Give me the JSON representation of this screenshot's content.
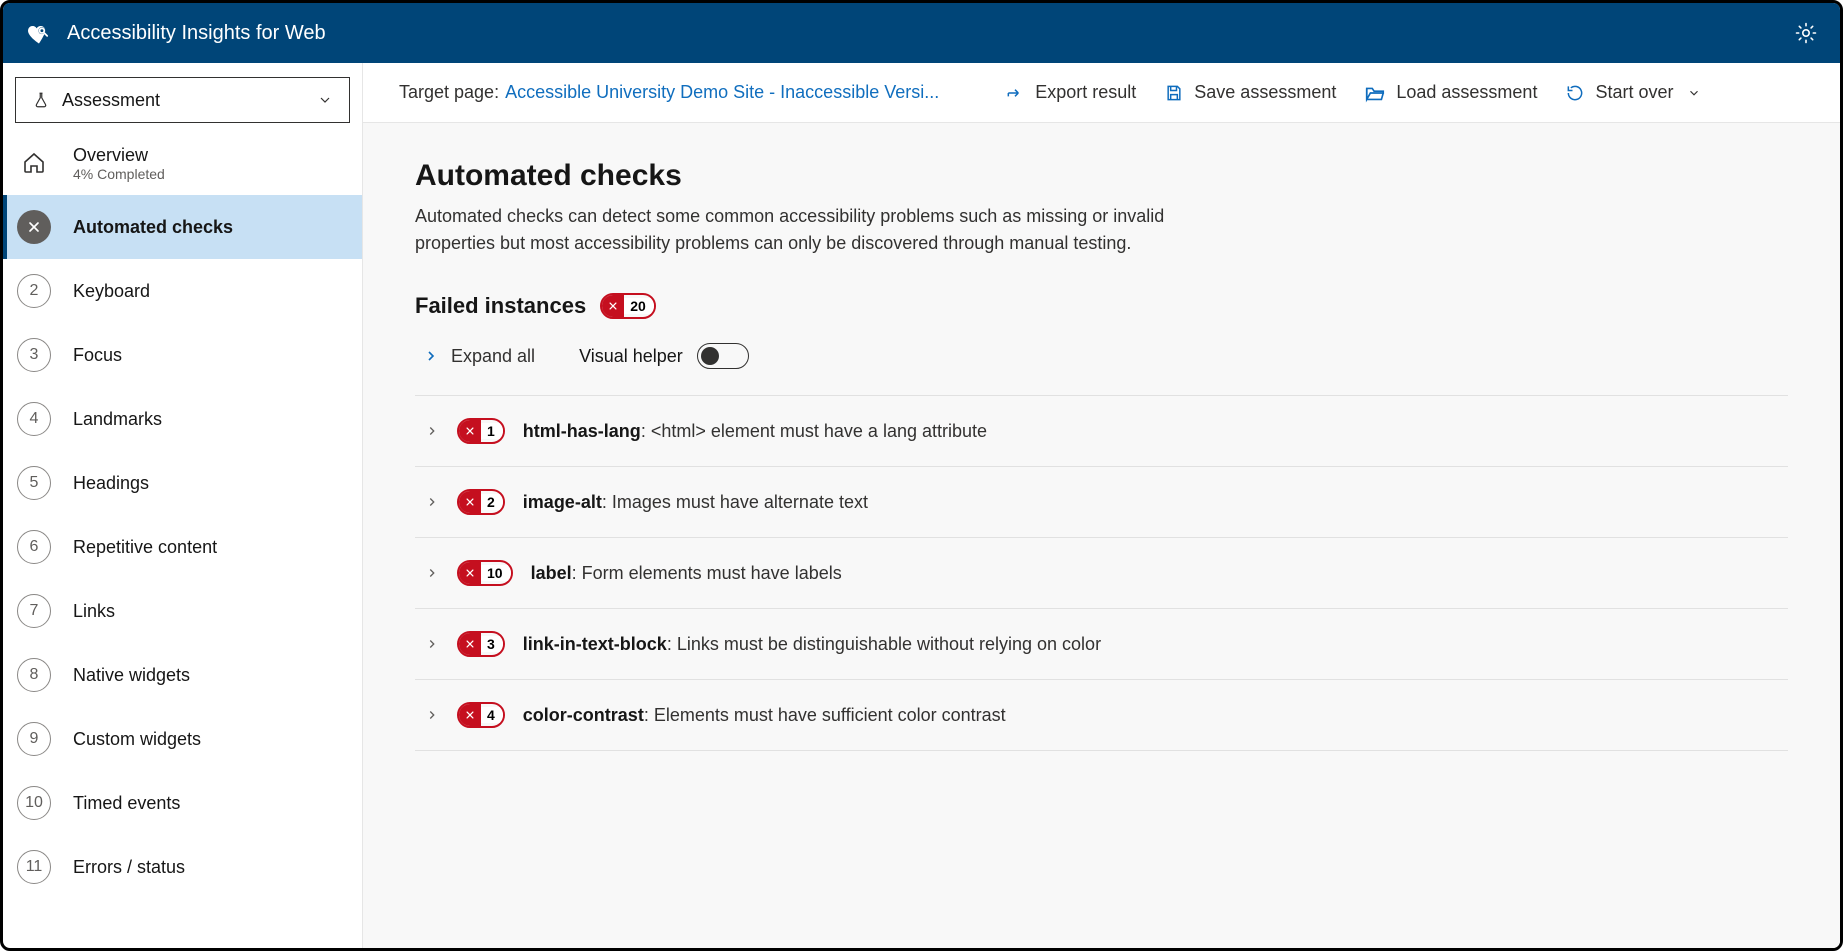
{
  "app": {
    "title": "Accessibility Insights for Web"
  },
  "dropdown": {
    "label": "Assessment"
  },
  "sidebar": {
    "overview": {
      "label": "Overview",
      "sub": "4% Completed"
    },
    "items": [
      {
        "icon": "fail",
        "label": "Automated checks",
        "active": true
      },
      {
        "num": "2",
        "label": "Keyboard"
      },
      {
        "num": "3",
        "label": "Focus"
      },
      {
        "num": "4",
        "label": "Landmarks"
      },
      {
        "num": "5",
        "label": "Headings"
      },
      {
        "num": "6",
        "label": "Repetitive content"
      },
      {
        "num": "7",
        "label": "Links"
      },
      {
        "num": "8",
        "label": "Native widgets"
      },
      {
        "num": "9",
        "label": "Custom widgets"
      },
      {
        "num": "10",
        "label": "Timed events"
      },
      {
        "num": "11",
        "label": "Errors / status"
      }
    ]
  },
  "toolbar": {
    "target_label": "Target page:",
    "target_link": "Accessible University Demo Site - Inaccessible Versi...",
    "export": "Export result",
    "save": "Save assessment",
    "load": "Load assessment",
    "start_over": "Start over"
  },
  "main": {
    "heading": "Automated checks",
    "description": "Automated checks can detect some common accessibility problems such as missing or invalid properties but most accessibility problems can only be discovered through manual testing.",
    "failed_heading": "Failed instances",
    "total_failures": "20",
    "expand_all": "Expand all",
    "visual_helper": "Visual helper",
    "rules": [
      {
        "count": "1",
        "id": "html-has-lang",
        "desc": "<html> element must have a lang attribute"
      },
      {
        "count": "2",
        "id": "image-alt",
        "desc": "Images must have alternate text"
      },
      {
        "count": "10",
        "id": "label",
        "desc": "Form elements must have labels"
      },
      {
        "count": "3",
        "id": "link-in-text-block",
        "desc": "Links must be distinguishable without relying on color"
      },
      {
        "count": "4",
        "id": "color-contrast",
        "desc": "Elements must have sufficient color contrast"
      }
    ]
  }
}
